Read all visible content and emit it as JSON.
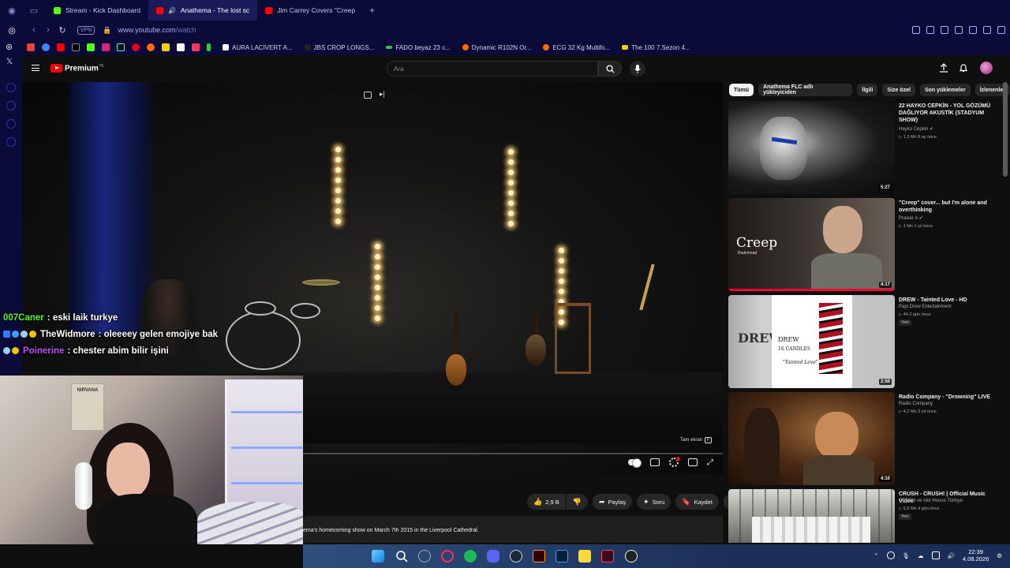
{
  "browser": {
    "tabs": [
      {
        "label": "Stream - Kick Dashboard",
        "color": "#53fc18",
        "active": false
      },
      {
        "label": "Anathema - The lost sc",
        "color": "#ff0000",
        "active": true
      },
      {
        "label": "Jim Carrey Covers \"Creep",
        "color": "#ff0000",
        "active": false
      }
    ],
    "add_tab": "+",
    "vpn_label": "VPN",
    "url_host": "www.youtube.com",
    "url_path": "/watch",
    "bookmarks": [
      {
        "label": "AURA LACİVERT A...",
        "color": "#ffffff"
      },
      {
        "label": "JBS CROP LONGS...",
        "color": "#222222"
      },
      {
        "label": "FADO beyaz 23 c...",
        "color": "#2ecc40"
      },
      {
        "label": "Dynamic R102N Or...",
        "color": "#ff6a00"
      },
      {
        "label": "ECG 32 Kg Multifo...",
        "color": "#ff6a00"
      },
      {
        "label": "The 100 7.Sezon 4...",
        "color": "#f5d100"
      }
    ]
  },
  "youtube": {
    "brand": "Premium",
    "brand_sup": "TR",
    "search_placeholder": "Ara"
  },
  "video": {
    "fullscreen_tip": "Tam ekran",
    "fullscreen_key": "F"
  },
  "chat": [
    {
      "user": "007Caner",
      "user_color": "#53fc18",
      "message": ": eski laik turkye"
    },
    {
      "user": "TheWidmore",
      "user_color": "#ffffff",
      "message": ": oleeeey gelen emojiye bak"
    },
    {
      "user": "Poinerine",
      "user_color": "#c14bff",
      "message": ": chester abim bilir işini"
    }
  ],
  "webcam": {
    "poster_text": "NIRVANA"
  },
  "actions": {
    "likes": "2,9 B",
    "share": "Paylaş",
    "ask": "Soru",
    "save": "Kaydet",
    "more": "⋯"
  },
  "description": "ema's homecoming show on March 7th 2015 in the  Liverpool Cathedral.",
  "chips": [
    "Tümü",
    "Anathema FLC adlı yükleyiciden",
    "İlgili",
    "Size özel",
    "Son yüklemeler",
    "İzlenenler"
  ],
  "recommendations": [
    {
      "title": "22 HAYKO CEPKİN - YOL GÖZÜMÜ DAĞLIYOR AKUSTİK (STADYUM SHOW)",
      "channel": "Hayko Cepkin",
      "meta": "1,3 Mn  8 ay önce",
      "duration": "5:27",
      "new": ""
    },
    {
      "title": "\"Creep\" cover... but I'm alone and overthinking",
      "channel": "Praiser A",
      "meta": "1 Mn  1 yıl önce",
      "duration": "4:17",
      "new": ""
    },
    {
      "title": "DREW - Tainted Love - HD",
      "channel": "Papi Drew Entertainment",
      "meta": "44  2 gün önce",
      "duration": "2:50",
      "new": "Yeni"
    },
    {
      "title": "Radio Company - \"Drowning\" LIVE",
      "channel": "Radio Company",
      "meta": "4,2 Mn  3 yıl önce",
      "duration": "4:10",
      "new": ""
    },
    {
      "title": "CRUSH - CRUSH! | Official Music Video",
      "channel": "CRUSH  ve Idol House Türkiye",
      "meta": "5,5 Mn  4 gün önce",
      "duration": "",
      "new": "Yeni"
    }
  ],
  "thumb_text": {
    "creep": "Creep",
    "creep_sub": "Radiohead",
    "drew_1": "DREW",
    "drew_2": "16 CANDLES",
    "drew_3": "\"Tainted Love\"",
    "drew_left": "DREW"
  },
  "taskbar": {
    "time": "22:39",
    "date": "4.08.2026"
  }
}
